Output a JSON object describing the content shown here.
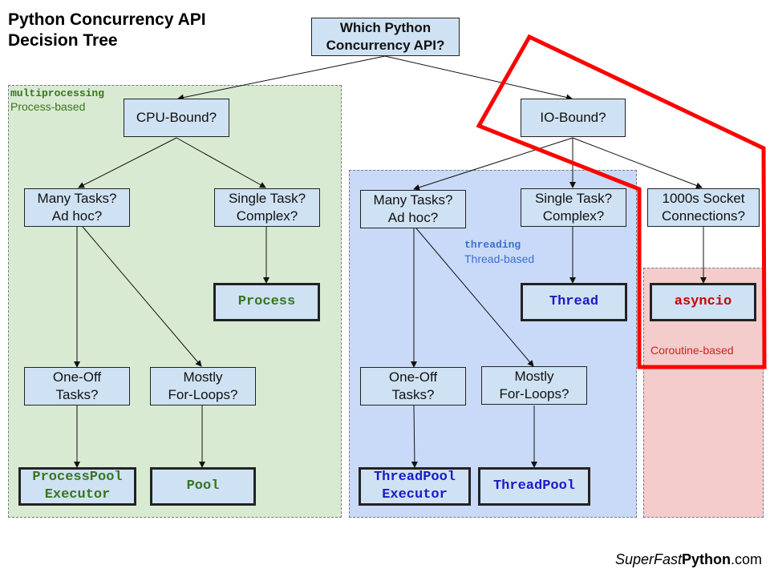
{
  "title": "Python Concurrency API\nDecision Tree",
  "title_lines": [
    "Python Concurrency API",
    "Decision Tree"
  ],
  "groups": {
    "multiprocessing": {
      "module": "multiprocessing",
      "kind": "Process-based",
      "color": "#38761d",
      "fill": "#d9ead3"
    },
    "threading": {
      "module": "threading",
      "kind": "Thread-based",
      "color": "#3c6fcf",
      "fill": "#c9daf8"
    },
    "asyncio": {
      "kind": "Coroutine-based",
      "color": "#cc2222",
      "fill": "#f4cccc"
    }
  },
  "nodes": {
    "root": "Which Python\nConcurrency API?",
    "cpu_bound": "CPU-Bound?",
    "io_bound": "IO-Bound?",
    "mp_many_tasks": "Many Tasks?\nAd hoc?",
    "mp_single_task": "Single Task?\nComplex?",
    "mp_one_off": "One-Off\nTasks?",
    "mp_for_loops": "Mostly\nFor-Loops?",
    "th_many_tasks": "Many Tasks?\nAd hoc?",
    "th_single_task": "Single Task?\nComplex?",
    "th_one_off": "One-Off\nTasks?",
    "th_for_loops": "Mostly\nFor-Loops?",
    "sockets": "1000s Socket\nConnections?"
  },
  "leaves": {
    "process": "Process",
    "process_pool_executor": "ProcessPool\nExecutor",
    "pool": "Pool",
    "thread": "Thread",
    "thread_pool_executor": "ThreadPool\nExecutor",
    "thread_pool": "ThreadPool",
    "asyncio": "asyncio"
  },
  "highlight": {
    "color": "#ff0000",
    "target": "asyncio path"
  },
  "footer": {
    "italic": "SuperFast",
    "bold": "Python",
    "tail": ".com"
  }
}
